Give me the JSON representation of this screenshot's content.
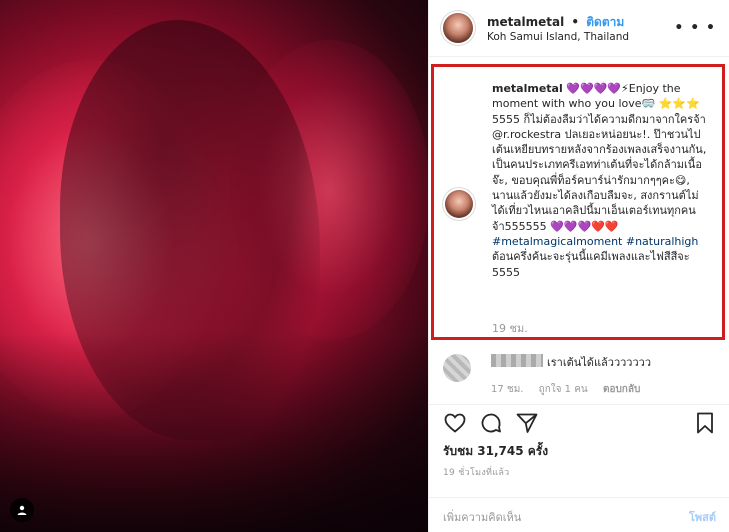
{
  "post": {
    "username": "metalmetal",
    "separator": "•",
    "follow_label": "ติดตาม",
    "location": "Koh Samui Island, Thailand",
    "more_icon": "more-options-icon"
  },
  "caption": {
    "username": "metalmetal",
    "body": "💜💜💜💜⚡Enjoy the moment with who you love🥽 ⭐⭐⭐ 5555 ก็ไม่ต้องลืมว่าได้ความดีกมาจากใครจ้า @r.rockestra ปลเยอะหน่อยนะ!. ป๊าชวนไปเต้นเหยียบทรายหลังจากร้องเพลงเสร็จงานกัน, เป็นคนประเภทครีเอทท่าเต้นที่จะได้กล้ามเนื้อจ๊ะ, ขอบคุณพี่ท็อร์คบาร์น่ารักมากๆๆคะ😋, นานแล้วยังมะได้ลงเกือบลืมจะ, สงกรานต์ไม่ได้เที่ยวไหนเอาคลิปนี้มาเอ็นเตอร์เทนทุกคนจ้า555555 💜💜💜❤️❤️",
    "hashtags": "#metalmagicalmoment #naturalhigh",
    "tail": "ต้อนครึ่งค้นะจะรุ่นนี้แคมีเพลงและไฟสีสีจะ 5555",
    "time": "19 ชม."
  },
  "comment": {
    "text": "เราเต้นได้แล้ววววววว",
    "time": "17 ชม.",
    "likes": "ถูกใจ 1 คน",
    "reply": "ตอบกลับ"
  },
  "actions": {
    "heart_icon": "heart-icon",
    "comment_icon": "comment-icon",
    "share_icon": "share-icon",
    "save_icon": "bookmark-icon"
  },
  "likes_label": "รับชม 31,745 ครั้ง",
  "posted_time": "19 ชั่วโมงที่แล้ว",
  "add_comment": {
    "placeholder": "เพิ่มความคิดเห็น",
    "post_label": "โพสต์"
  }
}
